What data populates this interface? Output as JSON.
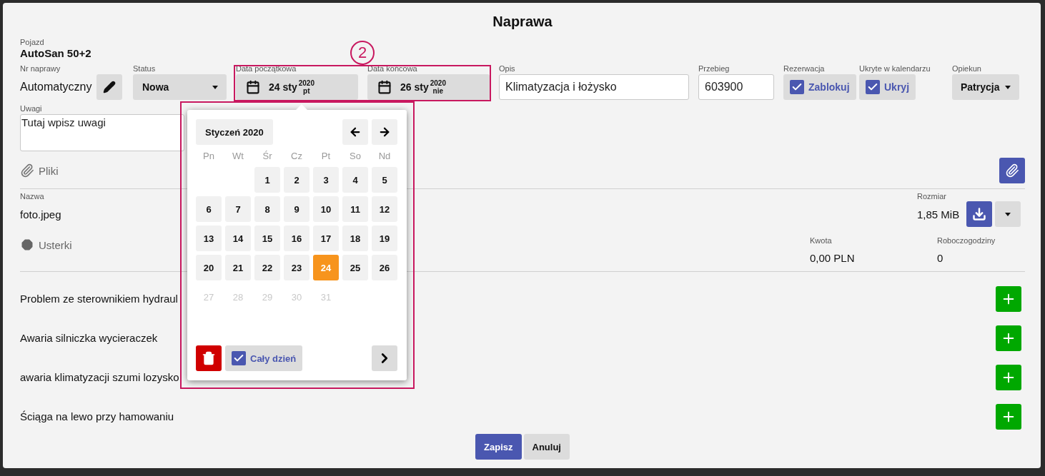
{
  "dialog": {
    "title": "Naprawa"
  },
  "vehicle": {
    "label": "Pojazd",
    "value": "AutoSan 50+2"
  },
  "fields": [
    {
      "kind": "number",
      "label": "Nr naprawy",
      "value": "Automatyczny"
    },
    {
      "kind": "select",
      "label": "Status",
      "value": "Nowa"
    },
    {
      "kind": "date",
      "label": "Data początkowa",
      "day": "24 sty",
      "year": "2020",
      "weekday": "pt"
    },
    {
      "kind": "date",
      "label": "Data końcowa",
      "day": "26 sty",
      "year": "2020",
      "weekday": "nie"
    },
    {
      "kind": "input",
      "label": "Opis",
      "value": "Klimatyzacja i łożysko"
    },
    {
      "kind": "input",
      "label": "Przebieg",
      "value": "603900"
    },
    {
      "kind": "checkbox",
      "label": "Rezerwacja",
      "text": "Zablokuj",
      "checked": true
    },
    {
      "kind": "checkbox",
      "label": "Ukryte w kalendarzu",
      "text": "Ukryj",
      "checked": true
    },
    {
      "kind": "dropdown",
      "label": "Opiekun",
      "value": "Patrycja"
    }
  ],
  "notes": {
    "label": "Uwagi",
    "value": "Tutaj wpisz uwagi"
  },
  "files": {
    "title": "Pliki",
    "name_label": "Nazwa",
    "size_label": "Rozmiar",
    "rows": [
      {
        "name": "foto.jpeg",
        "size": "1,85 MiB"
      }
    ]
  },
  "faults": {
    "title": "Usterki",
    "amount_label": "Kwota",
    "amount": "0,00 PLN",
    "hours_label": "Roboczogodziny",
    "hours": "0",
    "items": [
      {
        "text": "Problem ze sterownikiem hydraul"
      },
      {
        "text": "Awaria silniczka wycieraczek"
      },
      {
        "text": "awaria klimatyzacji szumi lozysko"
      },
      {
        "text": "Ściąga na lewo przy hamowaniu"
      }
    ]
  },
  "datepicker": {
    "month": "Styczeń 2020",
    "weekdays": [
      "Pn",
      "Wt",
      "Śr",
      "Cz",
      "Pt",
      "So",
      "Nd"
    ],
    "weeks": [
      [
        {
          "day": "1",
          "selected": false,
          "disabled": false
        },
        {
          "day": "2",
          "selected": false,
          "disabled": false
        },
        {
          "day": "3",
          "selected": false,
          "disabled": false
        },
        {
          "day": "4",
          "selected": false,
          "disabled": false
        },
        {
          "day": "5",
          "selected": false,
          "disabled": false
        }
      ],
      [
        {
          "day": "6",
          "selected": false,
          "disabled": false
        },
        {
          "day": "7",
          "selected": false,
          "disabled": false
        },
        {
          "day": "8",
          "selected": false,
          "disabled": false
        },
        {
          "day": "9",
          "selected": false,
          "disabled": false
        },
        {
          "day": "10",
          "selected": false,
          "disabled": false
        },
        {
          "day": "11",
          "selected": false,
          "disabled": false
        },
        {
          "day": "12",
          "selected": false,
          "disabled": false
        }
      ],
      [
        {
          "day": "13",
          "selected": false,
          "disabled": false
        },
        {
          "day": "14",
          "selected": false,
          "disabled": false
        },
        {
          "day": "15",
          "selected": false,
          "disabled": false
        },
        {
          "day": "16",
          "selected": false,
          "disabled": false
        },
        {
          "day": "17",
          "selected": false,
          "disabled": false
        },
        {
          "day": "18",
          "selected": false,
          "disabled": false
        },
        {
          "day": "19",
          "selected": false,
          "disabled": false
        }
      ],
      [
        {
          "day": "20",
          "selected": false,
          "disabled": false
        },
        {
          "day": "21",
          "selected": false,
          "disabled": false
        },
        {
          "day": "22",
          "selected": false,
          "disabled": false
        },
        {
          "day": "23",
          "selected": false,
          "disabled": false
        },
        {
          "day": "24",
          "selected": true,
          "disabled": false
        },
        {
          "day": "25",
          "selected": false,
          "disabled": false
        },
        {
          "day": "26",
          "selected": false,
          "disabled": false
        }
      ],
      [
        {
          "day": "27",
          "selected": false,
          "disabled": true
        },
        {
          "day": "28",
          "selected": false,
          "disabled": true
        },
        {
          "day": "29",
          "selected": false,
          "disabled": true
        },
        {
          "day": "30",
          "selected": false,
          "disabled": true
        },
        {
          "day": "31",
          "selected": false,
          "disabled": true
        }
      ]
    ],
    "all_day": {
      "text": "Cały dzień",
      "checked": true
    }
  },
  "annotation": {
    "label": "2"
  },
  "buttons": [
    {
      "kind": "primary",
      "label": "Zapisz"
    },
    {
      "kind": "secondary",
      "label": "Anuluj"
    }
  ]
}
